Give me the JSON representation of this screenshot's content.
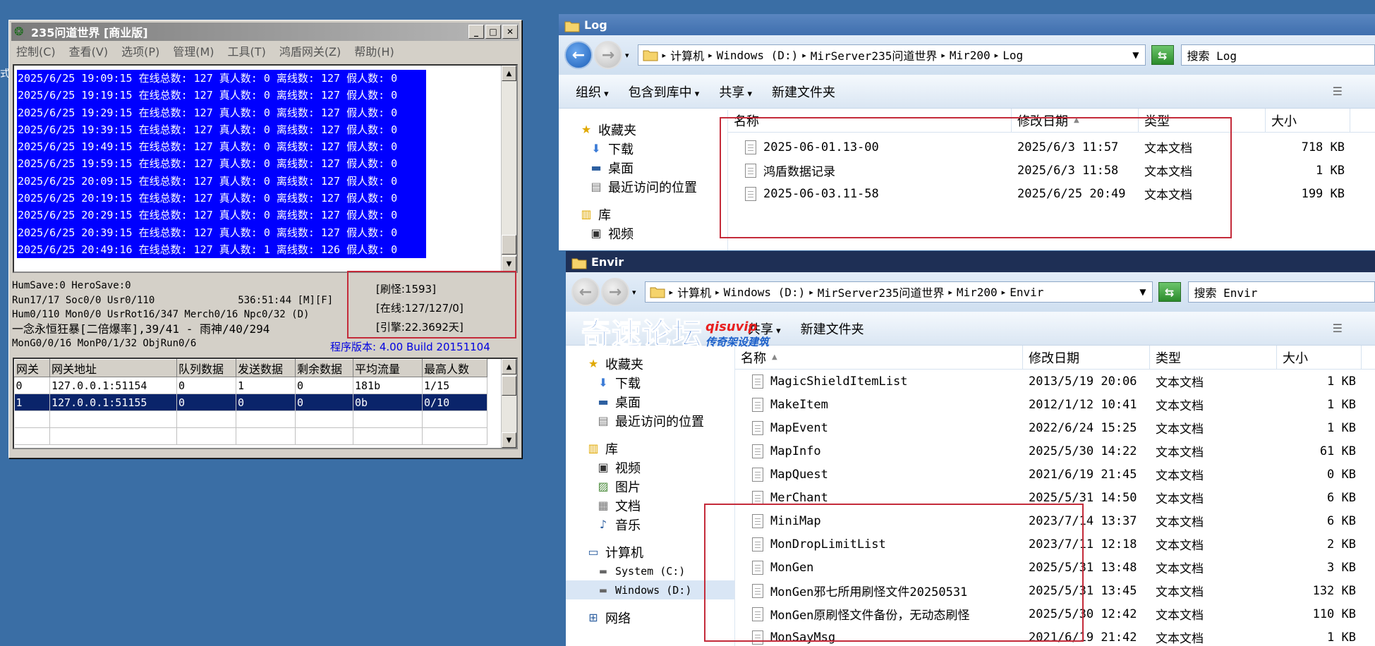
{
  "left_strip_text": "式",
  "m2": {
    "title": "235问道世界 [商业版]",
    "menu": [
      "控制(C)",
      "查看(V)",
      "选项(P)",
      "管理(M)",
      "工具(T)",
      "鸿盾网关(Z)",
      "帮助(H)"
    ],
    "log_lines": [
      "2025/6/25 19:09:15 在线总数: 127 真人数: 0 离线数: 127 假人数: 0",
      "2025/6/25 19:19:15 在线总数: 127 真人数: 0 离线数: 127 假人数: 0",
      "2025/6/25 19:29:15 在线总数: 127 真人数: 0 离线数: 127 假人数: 0",
      "2025/6/25 19:39:15 在线总数: 127 真人数: 0 离线数: 127 假人数: 0",
      "2025/6/25 19:49:15 在线总数: 127 真人数: 0 离线数: 127 假人数: 0",
      "2025/6/25 19:59:15 在线总数: 127 真人数: 0 离线数: 127 假人数: 0",
      "2025/6/25 20:09:15 在线总数: 127 真人数: 0 离线数: 127 假人数: 0",
      "2025/6/25 20:19:15 在线总数: 127 真人数: 0 离线数: 127 假人数: 0",
      "2025/6/25 20:29:15 在线总数: 127 真人数: 0 离线数: 127 假人数: 0",
      "2025/6/25 20:39:15 在线总数: 127 真人数: 0 离线数: 127 假人数: 0",
      "2025/6/25 20:49:16 在线总数: 127 真人数: 1 离线数: 126 假人数: 0"
    ],
    "status": {
      "l1": "HumSave:0 HeroSave:0",
      "l2a": "Run17/17 Soc0/0 Usr0/110",
      "l2b": "536:51:44 [M][F]",
      "l3": "Hum0/110 Mon0/0 UsrRot16/347 Merch0/16 Npc0/32 (D)",
      "l4": "一念永恒狂暴[二倍爆率],39/41 - 雨神/40/294",
      "l5": "MonG0/0/16 MonP0/1/32 ObjRun0/6",
      "panel1": "[刷怪:1593]",
      "panel2": "[在线:127/127/0]",
      "panel3": "[引擎:22.3692天]",
      "version": "程序版本: 4.00 Build 20151104"
    },
    "gateway_headers": [
      "网关",
      "网关地址",
      "队列数据",
      "发送数据",
      "剩余数据",
      "平均流量",
      "最高人数"
    ],
    "gateway_rows": [
      [
        "0",
        "127.0.0.1:51154",
        "0",
        "1",
        "0",
        "181b",
        "1/15"
      ],
      [
        "1",
        "127.0.0.1:51155",
        "0",
        "0",
        "0",
        "0b",
        "0/10"
      ]
    ]
  },
  "log_win": {
    "title": "Log",
    "breadcrumb": [
      "计算机",
      "Windows (D:)",
      "MirServer235问道世界",
      "Mir200",
      "Log"
    ],
    "search_placeholder": "搜索 Log",
    "toolbar": [
      "组织",
      "包含到库中",
      "共享",
      "新建文件夹"
    ],
    "nav": [
      {
        "label": "收藏夹",
        "icon": "star-icon"
      },
      {
        "label": "下载",
        "icon": "download-folder-icon"
      },
      {
        "label": "桌面",
        "icon": "desktop-icon"
      },
      {
        "label": "最近访问的位置",
        "icon": "recent-places-icon"
      },
      {
        "label": "库",
        "icon": "library-icon"
      },
      {
        "label": "视频",
        "icon": "video-icon"
      }
    ],
    "columns": [
      "名称",
      "修改日期",
      "类型",
      "大小"
    ],
    "files": [
      {
        "name": "2025-06-01.13-00",
        "date": "2025/6/3 11:57",
        "type": "文本文档",
        "size": "718 KB"
      },
      {
        "name": "鸿盾数据记录",
        "date": "2025/6/3 11:58",
        "type": "文本文档",
        "size": "1 KB"
      },
      {
        "name": "2025-06-03.11-58",
        "date": "2025/6/25 20:49",
        "type": "文本文档",
        "size": "199 KB"
      }
    ]
  },
  "envir_win": {
    "title": "Envir",
    "breadcrumb": [
      "计算机",
      "Windows (D:)",
      "MirServer235问道世界",
      "Mir200",
      "Envir"
    ],
    "search_placeholder": "搜索 Envir",
    "toolbar": [
      "共享",
      "新建文件夹"
    ],
    "nav": [
      {
        "label": "收藏夹",
        "icon": "star-icon"
      },
      {
        "label": "下载",
        "icon": "download-folder-icon"
      },
      {
        "label": "桌面",
        "icon": "desktop-icon"
      },
      {
        "label": "最近访问的位置",
        "icon": "recent-places-icon"
      },
      {
        "label": "库",
        "icon": "library-icon"
      },
      {
        "label": "视频",
        "icon": "video-icon"
      },
      {
        "label": "图片",
        "icon": "pictures-icon"
      },
      {
        "label": "文档",
        "icon": "documents-icon"
      },
      {
        "label": "音乐",
        "icon": "music-icon"
      },
      {
        "label": "计算机",
        "icon": "computer-icon"
      },
      {
        "label": "System (C:)",
        "icon": "drive-c-icon"
      },
      {
        "label": "Windows (D:)",
        "icon": "drive-d-icon"
      },
      {
        "label": "网络",
        "icon": "network-icon"
      }
    ],
    "columns": [
      "名称",
      "修改日期",
      "类型",
      "大小"
    ],
    "files": [
      {
        "name": "MagicShieldItemList",
        "date": "2013/5/19 20:06",
        "type": "文本文档",
        "size": "1 KB"
      },
      {
        "name": "MakeItem",
        "date": "2012/1/12 10:41",
        "type": "文本文档",
        "size": "1 KB"
      },
      {
        "name": "MapEvent",
        "date": "2022/6/24 15:25",
        "type": "文本文档",
        "size": "1 KB"
      },
      {
        "name": "MapInfo",
        "date": "2025/5/30 14:22",
        "type": "文本文档",
        "size": "61 KB"
      },
      {
        "name": "MapQuest",
        "date": "2021/6/19 21:45",
        "type": "文本文档",
        "size": "0 KB"
      },
      {
        "name": "MerChant",
        "date": "2025/5/31 14:50",
        "type": "文本文档",
        "size": "6 KB"
      },
      {
        "name": "MiniMap",
        "date": "2023/7/14 13:37",
        "type": "文本文档",
        "size": "6 KB"
      },
      {
        "name": "MonDropLimitList",
        "date": "2023/7/11 12:18",
        "type": "文本文档",
        "size": "2 KB"
      },
      {
        "name": "MonGen",
        "date": "2025/5/31 13:48",
        "type": "文本文档",
        "size": "3 KB"
      },
      {
        "name": "MonGen邪七所用刷怪文件20250531",
        "date": "2025/5/31 13:45",
        "type": "文本文档",
        "size": "132 KB"
      },
      {
        "name": "MonGen原刷怪文件备份，无动态刷怪",
        "date": "2025/5/30 12:42",
        "type": "文本文档",
        "size": "110 KB"
      },
      {
        "name": "MonSayMsg",
        "date": "2021/6/19 21:42",
        "type": "文本文档",
        "size": "1 KB"
      }
    ]
  },
  "watermark": {
    "main": "奇速论坛",
    "url": "qisuvip",
    "slogan": "传奇架设建筑"
  },
  "colors": {
    "desktop": "#3a6ea5",
    "selection_blue": "#0000ff",
    "annotation_red": "#c42b3a",
    "explorer_caption": "#2a5797"
  }
}
